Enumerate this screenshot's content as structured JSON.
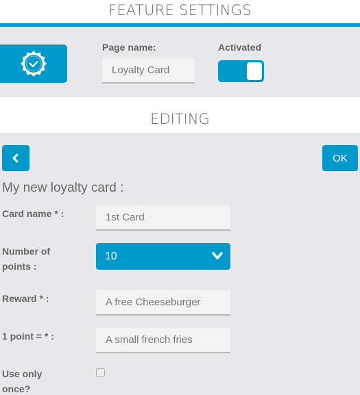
{
  "header": {
    "title": "FEATURE SETTINGS"
  },
  "feature": {
    "icon": "badge-check-icon",
    "page_name_label": "Page name:",
    "page_name_value": "Loyalty Card",
    "activated_label": "Activated",
    "activated": true
  },
  "editing": {
    "title": "EDITING",
    "back_icon": "chevron-left-icon",
    "ok_label": "OK",
    "section_title": "My new loyalty card :",
    "fields": {
      "card_name": {
        "label": "Card name * :",
        "value": "1st Card"
      },
      "number_of_points": {
        "label_line1": "Number of",
        "label_line2": "points :",
        "value": "10"
      },
      "reward": {
        "label": "Reward * :",
        "value": "A free Cheeseburger"
      },
      "one_point": {
        "label": "1 point = * :",
        "value": "A small french fries"
      },
      "use_only_once": {
        "label_line1": "Use only",
        "label_line2": "once?",
        "checked": false
      }
    }
  },
  "colors": {
    "accent": "#0099cc",
    "background": "#e8e8ea",
    "label": "#666666"
  }
}
